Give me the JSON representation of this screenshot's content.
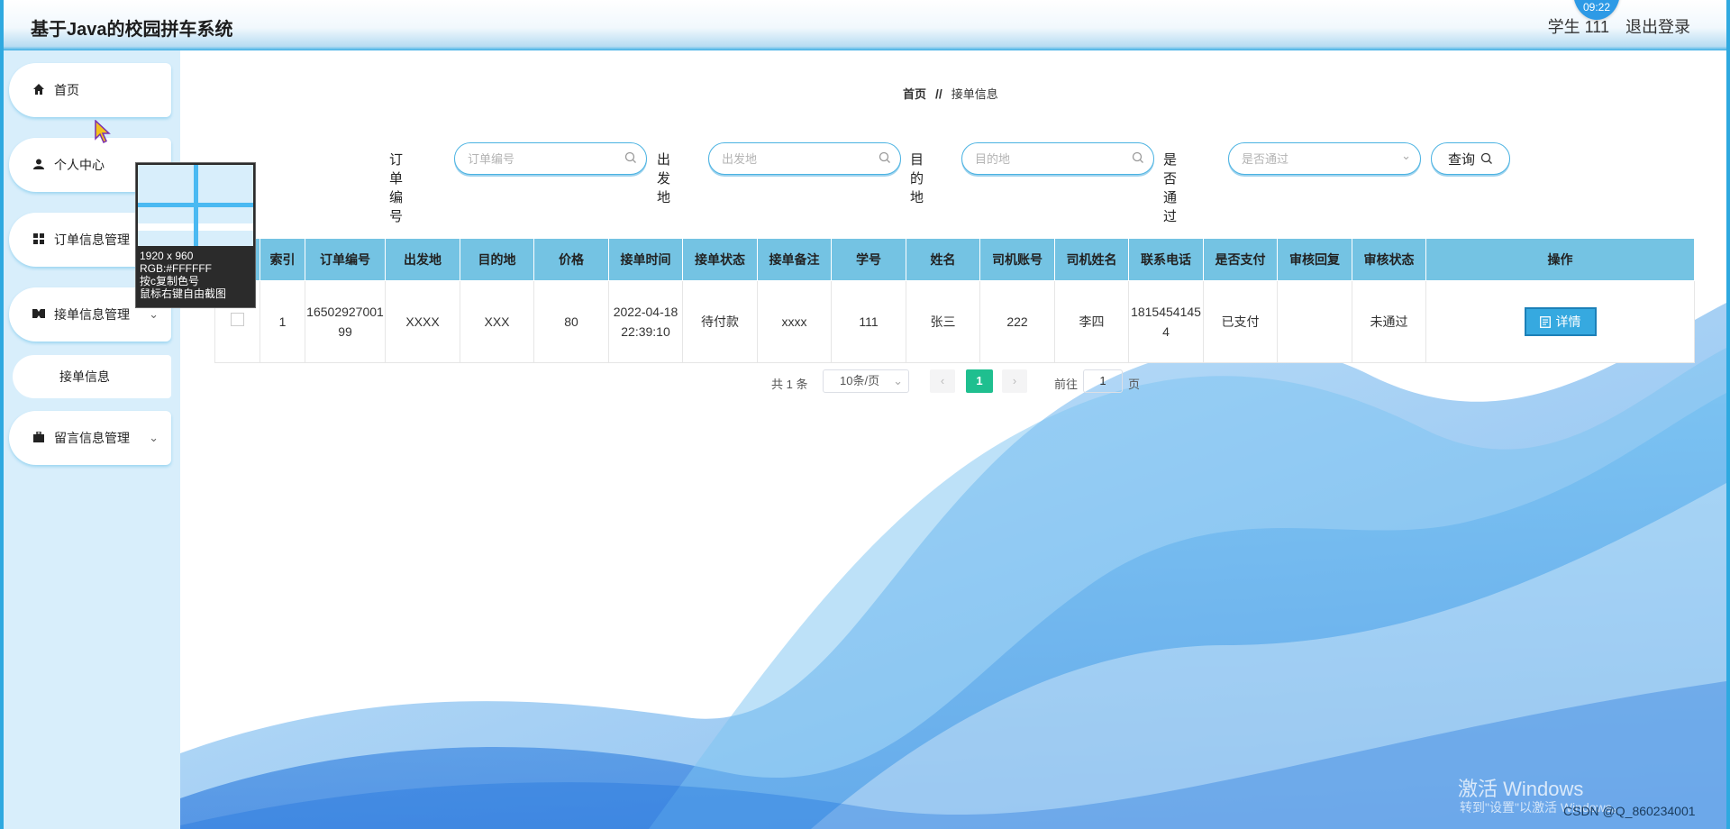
{
  "header": {
    "title": "基于Java的校园拼车系统",
    "user": "学生 111",
    "logout": "退出登录",
    "clock": "09:22"
  },
  "sidebar": {
    "items": [
      {
        "label": "首页",
        "icon": "home-icon"
      },
      {
        "label": "个人中心",
        "icon": "user-icon"
      },
      {
        "label": "订单信息管理",
        "icon": "grid-icon"
      },
      {
        "label": "接单信息管理",
        "icon": "ticket-icon"
      },
      {
        "label": "接单信息",
        "icon": ""
      },
      {
        "label": "留言信息管理",
        "icon": "briefcase-icon"
      }
    ]
  },
  "picker": {
    "size": "1920 x 960",
    "rgb": "RGB:#FFFFFF",
    "hint1": "按c复制色号",
    "hint2": "鼠标右键自由截图"
  },
  "breadcrumb": {
    "home": "首页",
    "sep": "//",
    "current": "接单信息"
  },
  "search": {
    "order_label": "订单编号",
    "order_placeholder": "订单编号",
    "from_label": "出发地",
    "from_placeholder": "出发地",
    "to_label": "目的地",
    "to_placeholder": "目的地",
    "pass_label": "是否通过",
    "pass_placeholder": "是否通过",
    "query_label": "查询"
  },
  "table": {
    "headers": [
      "",
      "索引",
      "订单编号",
      "出发地",
      "目的地",
      "价格",
      "接单时间",
      "接单状态",
      "接单备注",
      "学号",
      "姓名",
      "司机账号",
      "司机姓名",
      "联系电话",
      "是否支付",
      "审核回复",
      "审核状态",
      "操作"
    ],
    "rows": [
      {
        "index": "1",
        "order_no": "1650292700199",
        "from": "XXXX",
        "to": "XXX",
        "price": "80",
        "time": "2022-04-18 22:39:10",
        "status": "待付款",
        "remark": "xxxx",
        "student_id": "111",
        "name": "张三",
        "driver_account": "222",
        "driver_name": "李四",
        "phone": "18154541454",
        "paid": "已支付",
        "reply": "",
        "audit": "未通过",
        "action": "详情"
      }
    ]
  },
  "pagination": {
    "total": "共 1 条",
    "page_size": "10条/页",
    "current_page": "1",
    "goto_label": "前往",
    "goto_value": "1",
    "page_suffix": "页"
  },
  "overlay": {
    "activate": "激活 Windows",
    "activate_sub": "转到\"设置\"以激活 Windows。",
    "csdn": "CSDN @Q_860234001"
  },
  "colors": {
    "accent": "#36a9e0",
    "header_blue": "#74c3e3",
    "page_active": "#1fbf8f",
    "sidebar_bg": "#d8eefb"
  }
}
